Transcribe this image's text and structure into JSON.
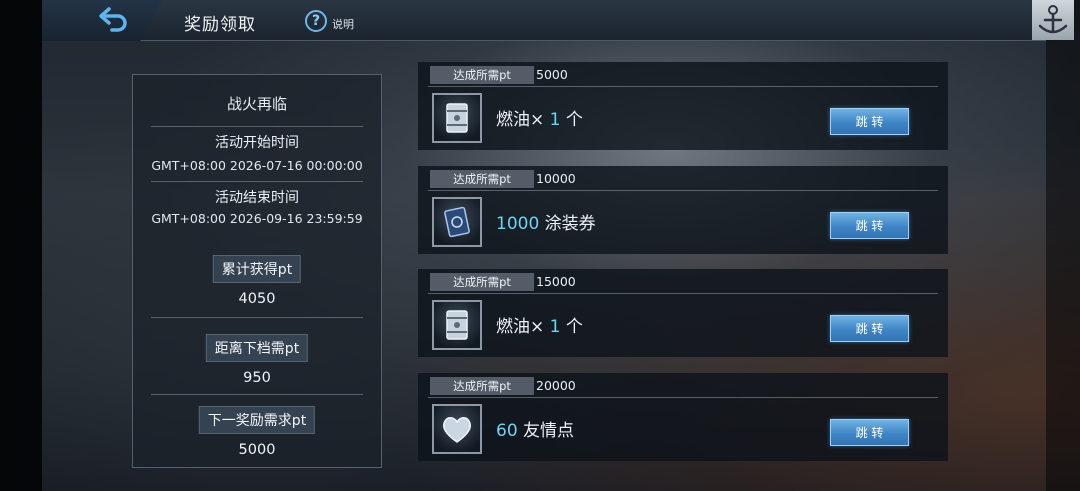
{
  "header": {
    "title": "奖励领取",
    "help_label": "说明"
  },
  "panel": {
    "event_name": "战火再临",
    "start_label": "活动开始时间",
    "start_time": "GMT+08:00 2026-07-16 00:00:00",
    "end_label": "活动结束时间",
    "end_time": "GMT+08:00 2026-09-16 23:59:59",
    "earned_label": "累计获得pt",
    "earned_value": "4050",
    "to_next_label": "距离下档需pt",
    "to_next_value": "950",
    "next_req_label": "下一奖励需求pt",
    "next_req_value": "5000"
  },
  "rewards": [
    {
      "req_label": "达成所需pt",
      "req_value": "5000",
      "icon": "fuel-barrel-icon",
      "prefix": "燃油× ",
      "num": "1",
      "suffix": " 个",
      "button": "跳 转"
    },
    {
      "req_label": "达成所需pt",
      "req_value": "10000",
      "icon": "paint-coupon-card-icon",
      "prefix": "",
      "num": "1000",
      "suffix": " 涂装券",
      "button": "跳 转"
    },
    {
      "req_label": "达成所需pt",
      "req_value": "15000",
      "icon": "fuel-barrel-icon",
      "prefix": "燃油× ",
      "num": "1",
      "suffix": " 个",
      "button": "跳 转"
    },
    {
      "req_label": "达成所需pt",
      "req_value": "20000",
      "icon": "heart-icon",
      "prefix": "",
      "num": "60",
      "suffix": " 友情点",
      "button": "跳 转"
    }
  ],
  "colors": {
    "accent": "#6fd3f2",
    "button": "#4a8fcf"
  }
}
